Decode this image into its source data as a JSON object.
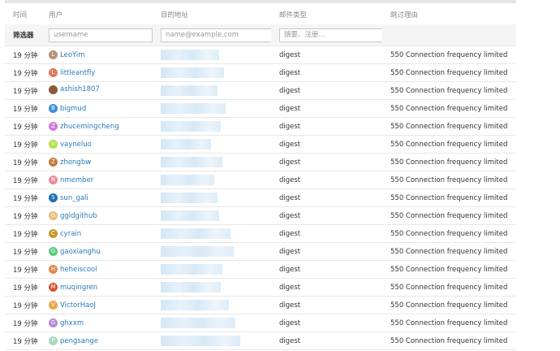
{
  "table": {
    "headers": [
      "时间",
      "用户",
      "目的地址",
      "邮件类型",
      "跳过理由"
    ],
    "filter": {
      "label": "筛选器",
      "username_placeholder": "username",
      "destination_placeholder": "name@example.com",
      "type_placeholder": "摘要、注册..."
    },
    "rows": [
      {
        "time": "19 分钟",
        "user": "LeoYim",
        "avatar_letter": "L",
        "avatar_color": "#b5937a",
        "type": "digest",
        "reason": "550 Connection frequency limited",
        "blur_w": 72
      },
      {
        "time": "19 分钟",
        "user": "littleantfly",
        "avatar_letter": "L",
        "avatar_color": "#e07a5a",
        "type": "digest",
        "reason": "550 Connection frequency limited",
        "blur_w": 78
      },
      {
        "time": "19 分钟",
        "user": "ashish1807",
        "avatar_letter": "",
        "avatar_color": "#8a5a3c",
        "type": "digest",
        "reason": "550 Connection frequency limited",
        "blur_w": 70
      },
      {
        "time": "19 分钟",
        "user": "bigmud",
        "avatar_letter": "B",
        "avatar_color": "#3a8fd8",
        "type": "digest",
        "reason": "550 Connection frequency limited",
        "blur_w": 80
      },
      {
        "time": "19 分钟",
        "user": "zhucemingcheng",
        "avatar_letter": "Z",
        "avatar_color": "#d27ad8",
        "type": "digest",
        "reason": "550 Connection frequency limited",
        "blur_w": 74
      },
      {
        "time": "19 分钟",
        "user": "vayneluo",
        "avatar_letter": "V",
        "avatar_color": "#b4e04a",
        "type": "digest",
        "reason": "550 Connection frequency limited",
        "blur_w": 62
      },
      {
        "time": "19 分钟",
        "user": "zhongbw",
        "avatar_letter": "Z",
        "avatar_color": "#c47a3a",
        "type": "digest",
        "reason": "550 Connection frequency limited",
        "blur_w": 76
      },
      {
        "time": "19 分钟",
        "user": "nmember",
        "avatar_letter": "N",
        "avatar_color": "#e88a9a",
        "type": "digest",
        "reason": "550 Connection frequency limited",
        "blur_w": 66
      },
      {
        "time": "19 分钟",
        "user": "sun_gali",
        "avatar_letter": "S",
        "avatar_color": "#1f6fb5",
        "type": "digest",
        "reason": "550 Connection frequency limited",
        "blur_w": 70
      },
      {
        "time": "19 分钟",
        "user": "ggldgithub",
        "avatar_letter": "G",
        "avatar_color": "#e8c07a",
        "type": "digest",
        "reason": "550 Connection frequency limited",
        "blur_w": 72
      },
      {
        "time": "19 分钟",
        "user": "cyrain",
        "avatar_letter": "C",
        "avatar_color": "#c49a2a",
        "type": "digest",
        "reason": "550 Connection frequency limited",
        "blur_w": 86
      },
      {
        "time": "19 分钟",
        "user": "gaoxianghu",
        "avatar_letter": "G",
        "avatar_color": "#5ac87a",
        "type": "digest",
        "reason": "550 Connection frequency limited",
        "blur_w": 90
      },
      {
        "time": "19 分钟",
        "user": "heheiscool",
        "avatar_letter": "H",
        "avatar_color": "#e08a4a",
        "type": "digest",
        "reason": "550 Connection frequency limited",
        "blur_w": 76
      },
      {
        "time": "19 分钟",
        "user": "muqingren",
        "avatar_letter": "M",
        "avatar_color": "#d4583a",
        "type": "digest",
        "reason": "550 Connection frequency limited",
        "blur_w": 74
      },
      {
        "time": "19 分钟",
        "user": "VictorHaoJ",
        "avatar_letter": "V",
        "avatar_color": "#e8a84a",
        "type": "digest",
        "reason": "550 Connection frequency limited",
        "blur_w": 84
      },
      {
        "time": "19 分钟",
        "user": "ghxxm",
        "avatar_letter": "G",
        "avatar_color": "#b48ad8",
        "type": "digest",
        "reason": "550 Connection frequency limited",
        "blur_w": 92
      },
      {
        "time": "19 分钟",
        "user": "pengsange",
        "avatar_letter": "P",
        "avatar_color": "#a8d8b8",
        "type": "digest",
        "reason": "550 Connection frequency limited",
        "blur_w": 98
      }
    ]
  }
}
